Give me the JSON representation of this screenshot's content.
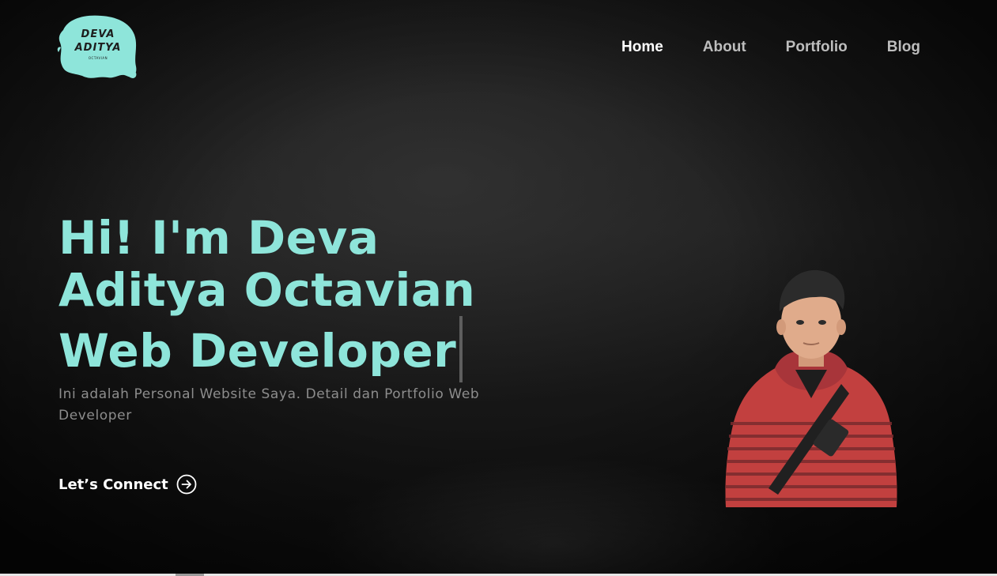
{
  "logo": {
    "line1": "DEVA",
    "line2": "ADITYA",
    "line3": "OCTAVIAN",
    "color": "#8ee5da"
  },
  "nav": {
    "items": [
      {
        "label": "Home",
        "active": true
      },
      {
        "label": "About",
        "active": false
      },
      {
        "label": "Portfolio",
        "active": false
      },
      {
        "label": "Blog",
        "active": false
      }
    ]
  },
  "hero": {
    "title": "Hi! I'm Deva Aditya Octavian Web Developer",
    "subtitle": "Ini adalah Personal Website Saya. Detail dan Portfolio Web Developer",
    "cta_label": "Let’s Connect",
    "cta_icon": "arrow-right-circle-icon"
  },
  "colors": {
    "accent": "#8ee5da",
    "background": "#141414",
    "nav_active": "#ffffff",
    "nav_inactive": "#bdbdbd",
    "subtitle": "#8d8d8d"
  }
}
